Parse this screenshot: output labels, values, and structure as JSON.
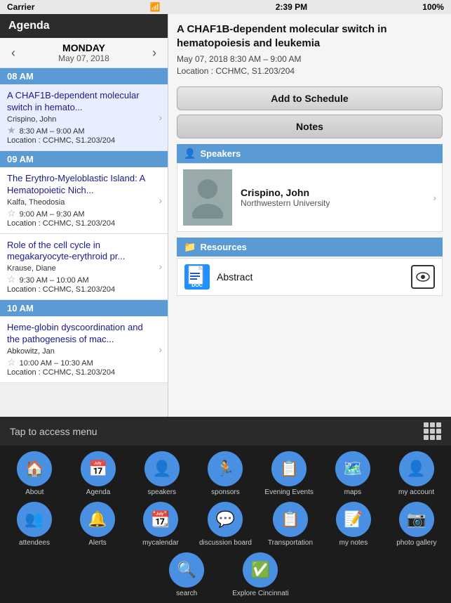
{
  "statusBar": {
    "carrier": "Carrier",
    "time": "2:39 PM",
    "battery": "100%"
  },
  "agenda": {
    "header": "Agenda",
    "dayName": "MONDAY",
    "dayDate": "May 07, 2018",
    "prevArrow": "‹",
    "nextArrow": "›",
    "timeSlots": [
      {
        "time": "08 AM",
        "items": [
          {
            "title": "A CHAF1B-dependent molecular switch in hemato...",
            "author": "Crispino, John",
            "timeRange": "8:30 AM – 9:00 AM",
            "location": "Location : CCHMC, S1.203/204",
            "selected": true
          }
        ]
      },
      {
        "time": "09 AM",
        "items": [
          {
            "title": "The Erythro-Myeloblastic Island: A Hematopoietic Nich...",
            "author": "Kalfa, Theodosia",
            "timeRange": "9:00 AM – 9:30 AM",
            "location": "Location : CCHMC, S1.203/204",
            "selected": false
          },
          {
            "title": "Role of the cell cycle in megakaryocyte-erythroid pr...",
            "author": "Krause, Diane",
            "timeRange": "9:30 AM – 10:00 AM",
            "location": "Location : CCHMC, S1.203/204",
            "selected": false
          }
        ]
      },
      {
        "time": "10 AM",
        "items": [
          {
            "title": "Heme-globin dyscoordination and the pathogenesis of mac...",
            "author": "Abkowitz, Jan",
            "timeRange": "10:00 AM – 10:30 AM",
            "location": "Location : CCHMC, S1.203/204",
            "selected": false
          }
        ]
      }
    ]
  },
  "detail": {
    "title": "A CHAF1B-dependent molecular switch in hematopoiesis and leukemia",
    "date": "May 07, 2018 8:30 AM – 9:00 AM",
    "location": "Location : CCHMC, S1.203/204",
    "addToScheduleLabel": "Add to Schedule",
    "notesLabel": "Notes",
    "speakersSectionLabel": "Speakers",
    "speaker": {
      "name": "Crispino, John",
      "org": "Northwestern University"
    },
    "resourcesSectionLabel": "Resources",
    "resource": {
      "name": "Abstract",
      "type": "DOC"
    }
  },
  "bottomBar": {
    "tapMenuLabel": "Tap to access menu",
    "navRow1": [
      {
        "id": "about",
        "label": "About",
        "icon": "🏠"
      },
      {
        "id": "agenda",
        "label": "Agenda",
        "icon": "📅"
      },
      {
        "id": "speakers",
        "label": "speakers",
        "icon": "👤"
      },
      {
        "id": "sponsors",
        "label": "sponsors",
        "icon": "🏃"
      },
      {
        "id": "evening-events",
        "label": "Evening Events",
        "icon": "📋"
      },
      {
        "id": "maps",
        "label": "maps",
        "icon": "🗺️"
      },
      {
        "id": "my-account",
        "label": "my account",
        "icon": "👤"
      }
    ],
    "navRow2": [
      {
        "id": "attendees",
        "label": "attendees",
        "icon": "👥"
      },
      {
        "id": "alerts",
        "label": "Alerts",
        "icon": "🔔"
      },
      {
        "id": "mycalendar",
        "label": "mycalendar",
        "icon": "📆"
      },
      {
        "id": "discussion-board",
        "label": "discussion board",
        "icon": "💬"
      },
      {
        "id": "transportation",
        "label": "Transportation",
        "icon": "📋"
      },
      {
        "id": "my-notes",
        "label": "my notes",
        "icon": "📝"
      },
      {
        "id": "photo-gallery",
        "label": "photo gallery",
        "icon": "📷"
      }
    ],
    "navRow3": [
      {
        "id": "search",
        "label": "search",
        "icon": "🔍"
      },
      {
        "id": "explore-cincinnati",
        "label": "Explore Cincinnati",
        "icon": "✅"
      }
    ]
  }
}
